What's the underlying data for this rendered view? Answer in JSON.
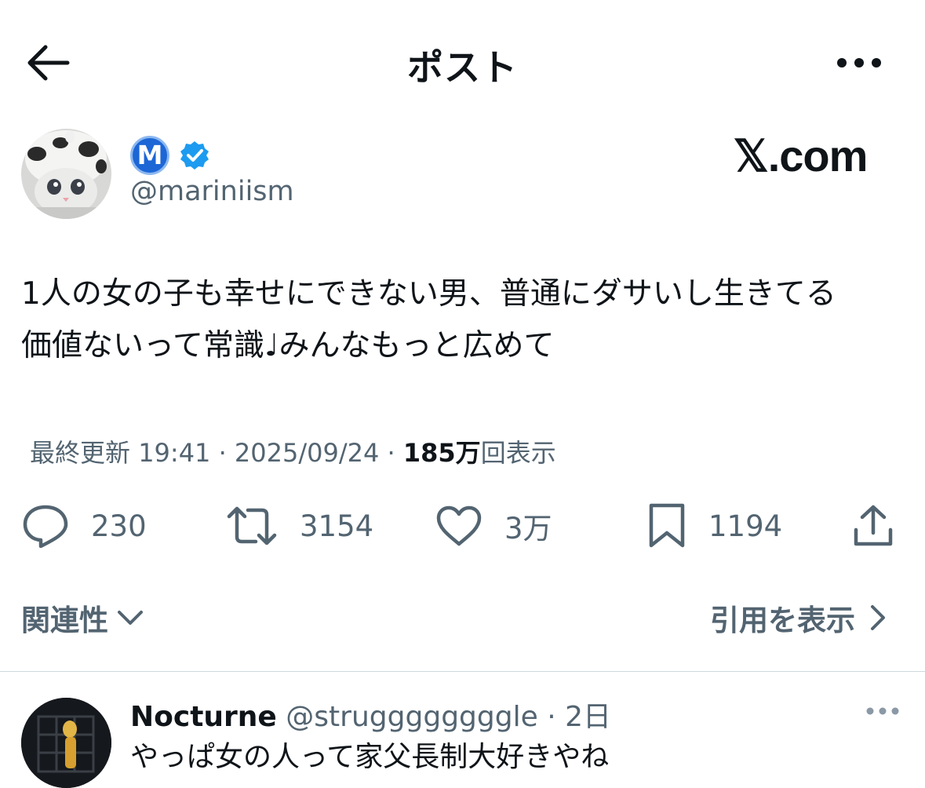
{
  "header": {
    "title": "ポスト",
    "back_icon": "arrow-left-icon",
    "more_icon": "more-horizontal-icon"
  },
  "author": {
    "badge_letter": "M",
    "handle": "@mariniism",
    "verified_icon": "verified-badge-icon",
    "verified_color": "#1d9bf0"
  },
  "watermark": "𝕏.com",
  "post": {
    "line1": "1人の女の子も幸せにできない男、普通にダサいし生きてる",
    "line2": "価値ないって常識♩みんなもっと広めて"
  },
  "meta": {
    "updated_label": "最終更新",
    "time": "19:41",
    "sep1": " · ",
    "date": "2025/09/24",
    "sep2": " · ",
    "views_count": "185万",
    "views_label": "回表示"
  },
  "actions": {
    "replies": "230",
    "reposts": "3154",
    "likes": "3万",
    "bookmarks": "1194"
  },
  "tabs": {
    "related": "関連性",
    "quotes": "引用を表示"
  },
  "reply": {
    "name": "Nocturne",
    "handle": "@struggggggggle",
    "sep": " · ",
    "age": "2日",
    "text": "やっぱ女の人って家父長制大好きやね"
  }
}
